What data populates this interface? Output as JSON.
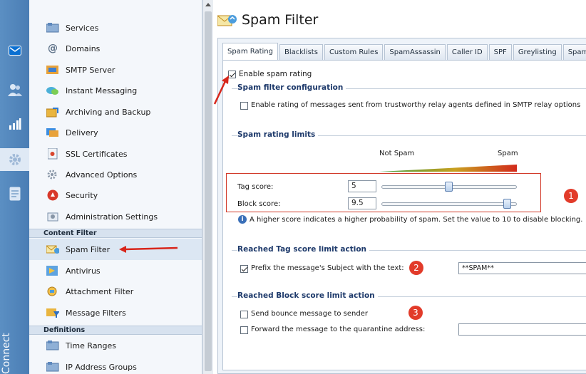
{
  "app": {
    "brand_word": "Connect"
  },
  "colors": {
    "accent": "#4a7db4",
    "callout": "#e23b2a",
    "group_title": "#1e3a6b"
  },
  "icon_strip": [
    {
      "icon": "mail-icon"
    },
    {
      "icon": "users-icon"
    },
    {
      "icon": "statistics-icon"
    },
    {
      "icon": "settings-gear-icon",
      "selected": true
    },
    {
      "icon": "notes-icon"
    }
  ],
  "sidebar": {
    "items": [
      {
        "label": "Services",
        "icon": "services-icon"
      },
      {
        "label": "Domains",
        "icon": "domains-at-icon"
      },
      {
        "label": "SMTP Server",
        "icon": "smtp-server-icon"
      },
      {
        "label": "Instant Messaging",
        "icon": "instant-messaging-icon"
      },
      {
        "label": "Archiving and Backup",
        "icon": "archiving-icon"
      },
      {
        "label": "Delivery",
        "icon": "delivery-icon"
      },
      {
        "label": "SSL Certificates",
        "icon": "ssl-certificate-icon"
      },
      {
        "label": "Advanced Options",
        "icon": "advanced-options-icon"
      },
      {
        "label": "Security",
        "icon": "security-icon"
      },
      {
        "label": "Administration Settings",
        "icon": "administration-icon"
      }
    ],
    "section_content_filter": "Content Filter",
    "content_filter_items": [
      {
        "label": "Spam Filter",
        "icon": "spam-filter-icon",
        "selected": true
      },
      {
        "label": "Antivirus",
        "icon": "antivirus-icon"
      },
      {
        "label": "Attachment Filter",
        "icon": "attachment-filter-icon"
      },
      {
        "label": "Message Filters",
        "icon": "message-filters-icon"
      }
    ],
    "section_definitions": "Definitions",
    "definitions_items": [
      {
        "label": "Time Ranges",
        "icon": "time-ranges-icon"
      },
      {
        "label": "IP Address Groups",
        "icon": "ip-groups-icon"
      }
    ]
  },
  "page": {
    "title": "Spam Filter"
  },
  "tabs": [
    "Spam Rating",
    "Blacklists",
    "Custom Rules",
    "SpamAssassin",
    "Caller ID",
    "SPF",
    "Greylisting",
    "Spam R"
  ],
  "active_tab": "Spam Rating",
  "spam_rating": {
    "enable_label": "Enable spam rating",
    "enable_checked": true,
    "config_title": "Spam filter configuration",
    "trusted_label": "Enable rating of messages sent from trustworthy relay agents defined in SMTP relay options",
    "trusted_checked": false,
    "limits_title": "Spam rating limits",
    "scale_left": "Not Spam",
    "scale_right": "Spam",
    "tag_label": "Tag score:",
    "tag_value": "5",
    "tag_slider_fraction": 0.5,
    "block_label": "Block score:",
    "block_value": "9.5",
    "block_slider_fraction": 0.95,
    "hint": "A higher score indicates a higher probability of spam. Set the value to 10 to disable blocking.",
    "tag_action_title": "Reached Tag score limit action",
    "prefix_label": "Prefix the message's Subject with the text:",
    "prefix_checked": true,
    "prefix_value": "**SPAM**",
    "block_action_title": "Reached Block score limit action",
    "bounce_label": "Send bounce message to sender",
    "bounce_checked": false,
    "forward_label": "Forward the message to the quarantine address:",
    "forward_checked": false,
    "forward_value": ""
  },
  "callouts": [
    "1",
    "2",
    "3"
  ]
}
